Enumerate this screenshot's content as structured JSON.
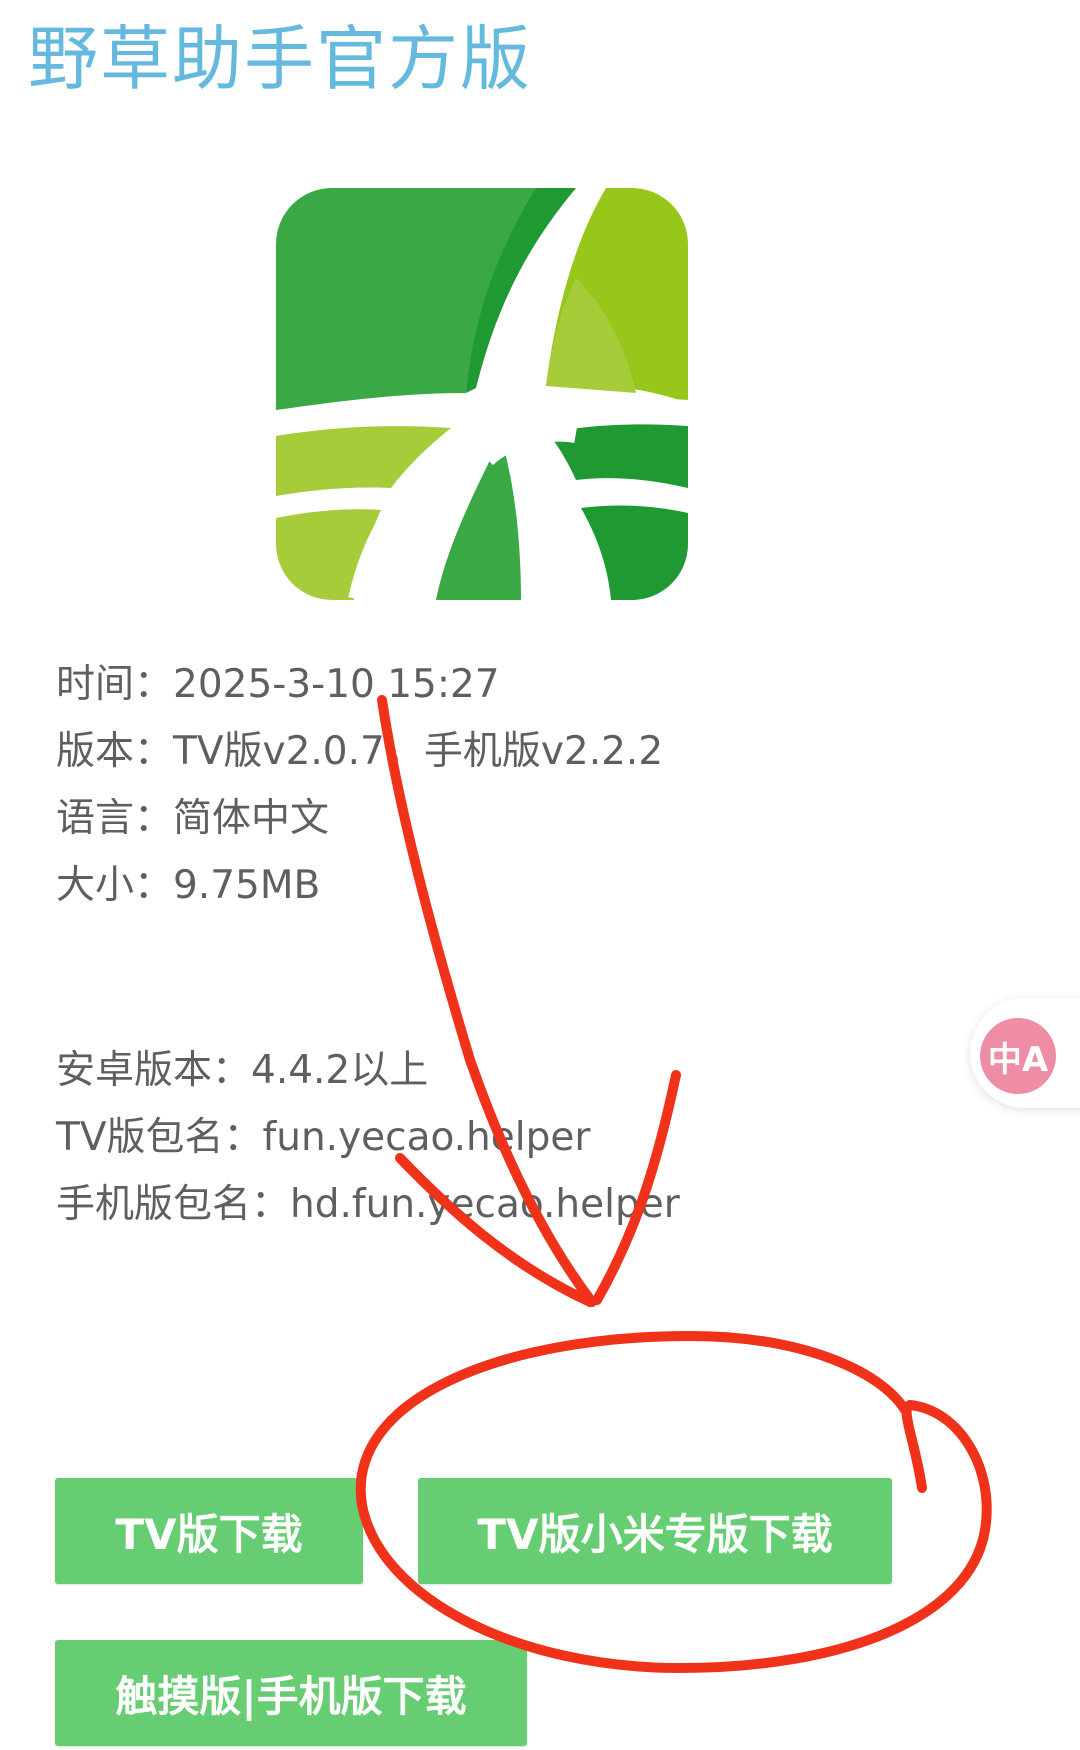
{
  "title": "野草助手官方版",
  "info": {
    "time": "时间：2025-3-10 15:27",
    "version": "版本：TV版v2.0.7，手机版v2.2.2",
    "language": "语言：简体中文",
    "size": "大小：9.75MB",
    "android": "安卓版本：4.4.2以上",
    "tv_package": "TV版包名：fun.yecao.helper",
    "phone_package": "手机版包名：hd.fun.yecao.helper"
  },
  "buttons": {
    "tv_download": "TV版下载",
    "tv_xiaomi_download": "TV版小米专版下载",
    "touch_phone_download": "触摸版|手机版下载"
  },
  "translate": {
    "glyph": "中A"
  },
  "colors": {
    "title": "#66b9de",
    "button": "#66cd72",
    "text": "#5f5f5f",
    "annotation": "#f0321a",
    "logo_dark_green": "#1f9a33",
    "logo_mid_green": "#3aa845",
    "logo_light_green": "#a7cc3a",
    "logo_lime": "#98c71c"
  },
  "icons": {
    "logo": "yecao-grass-logo-icon",
    "translate": "translate-icon"
  }
}
